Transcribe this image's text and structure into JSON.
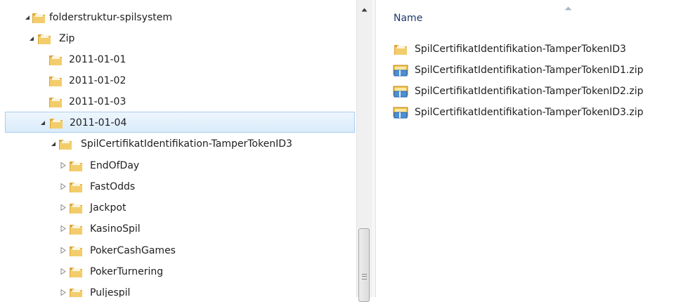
{
  "tree": {
    "nodes": [
      {
        "label": "folderstruktur-spilsystem",
        "expander": "expanded"
      },
      {
        "label": "Zip",
        "expander": "expanded"
      },
      {
        "label": "2011-01-01",
        "expander": "none"
      },
      {
        "label": "2011-01-02",
        "expander": "none"
      },
      {
        "label": "2011-01-03",
        "expander": "none"
      },
      {
        "label": "2011-01-04",
        "expander": "expanded",
        "selected": true
      },
      {
        "label": "SpilCertifikatIdentifikation-TamperTokenID3",
        "expander": "expanded"
      },
      {
        "label": "EndOfDay",
        "expander": "collapsed"
      },
      {
        "label": "FastOdds",
        "expander": "collapsed"
      },
      {
        "label": "Jackpot",
        "expander": "collapsed"
      },
      {
        "label": "KasinoSpil",
        "expander": "collapsed"
      },
      {
        "label": "PokerCashGames",
        "expander": "collapsed"
      },
      {
        "label": "PokerTurnering",
        "expander": "collapsed"
      },
      {
        "label": "Puljespil",
        "expander": "collapsed"
      }
    ]
  },
  "list": {
    "column_header": "Name",
    "sort": "ascending",
    "items": [
      {
        "name": "SpilCertifikatIdentifikation-TamperTokenID3",
        "icon": "folder-icon"
      },
      {
        "name": "SpilCertifikatIdentifikation-TamperTokenID1.zip",
        "icon": "zip-folder-icon"
      },
      {
        "name": "SpilCertifikatIdentifikation-TamperTokenID2.zip",
        "icon": "zip-folder-icon"
      },
      {
        "name": "SpilCertifikatIdentifikation-TamperTokenID3.zip",
        "icon": "zip-folder-icon"
      }
    ]
  },
  "colors": {
    "folder": "#e8b84a",
    "selection": "#d9ebfa",
    "selection_border": "#a9cdf0",
    "header_text": "#1e3a6e"
  }
}
